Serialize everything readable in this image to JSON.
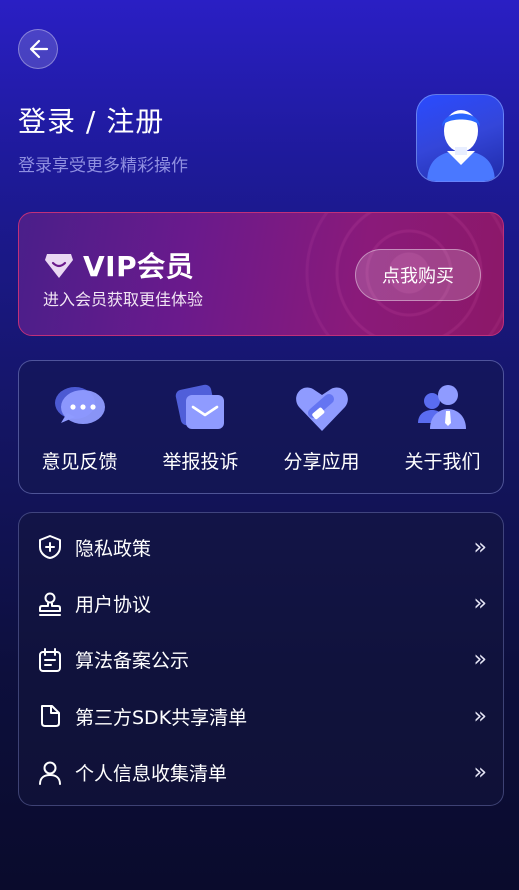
{
  "header": {
    "title": "登录 / 注册",
    "subtitle": "登录享受更多精彩操作"
  },
  "vip": {
    "title": "VIP会员",
    "subtitle": "进入会员获取更佳体验",
    "buy_label": "点我购买"
  },
  "quick_actions": [
    {
      "label": "意见反馈",
      "icon": "chat-bubble-icon"
    },
    {
      "label": "举报投诉",
      "icon": "mail-icon"
    },
    {
      "label": "分享应用",
      "icon": "heart-share-icon"
    },
    {
      "label": "关于我们",
      "icon": "team-icon"
    }
  ],
  "menu": [
    {
      "label": "隐私政策",
      "icon": "shield-plus-icon",
      "arrow": "»"
    },
    {
      "label": "用户协议",
      "icon": "stamp-icon",
      "arrow": "»"
    },
    {
      "label": "算法备案公示",
      "icon": "calendar-icon",
      "arrow": "»"
    },
    {
      "label": "第三方SDK共享清单",
      "icon": "document-icon",
      "arrow": "»"
    },
    {
      "label": "个人信息收集清单",
      "icon": "person-icon",
      "arrow": "»"
    }
  ],
  "colors": {
    "accent_blue": "#2a4bff",
    "vip_pink": "#c0307a",
    "icon_lavender": "#8f9bff"
  }
}
